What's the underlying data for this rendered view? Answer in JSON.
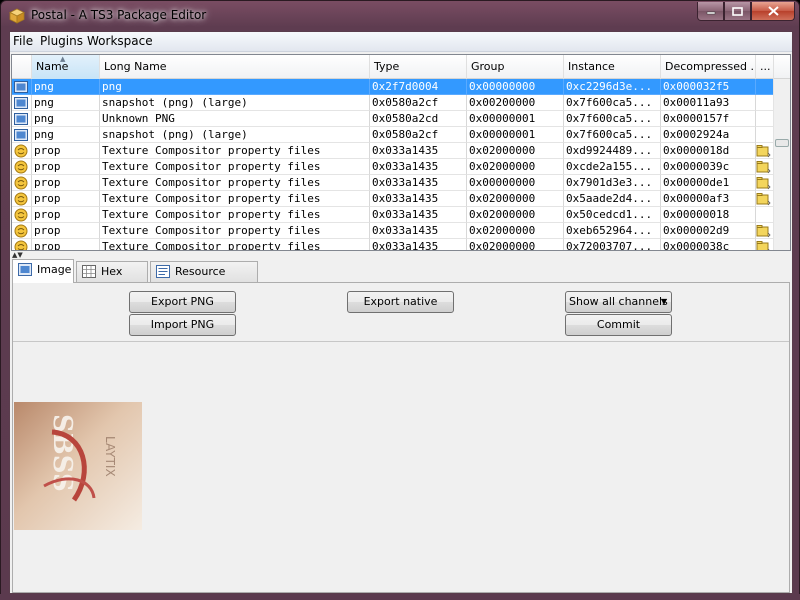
{
  "window": {
    "title": "Postal - A TS3 Package Editor",
    "accent": "#3399ff"
  },
  "caption_buttons": {
    "minimize": "minimize-icon",
    "maximize": "maximize-icon",
    "close": "close-icon"
  },
  "menu": [
    "File",
    "Plugins",
    "Workspace"
  ],
  "grid": {
    "columns": [
      "Name",
      "Long Name",
      "Type",
      "Group",
      "Instance",
      "Decompressed ...",
      "..."
    ],
    "sorted_column": "Name",
    "rows": [
      {
        "icon": "image-icon",
        "name": "png",
        "long_name": "png",
        "type": "0x2f7d0004",
        "group": "0x00000000",
        "instance": "0xc2296d3e...",
        "decompressed": "0x000032f5",
        "side_icon": "",
        "selected": true
      },
      {
        "icon": "image-icon",
        "name": "png",
        "long_name": "snapshot (png) (large)",
        "type": "0x0580a2cf",
        "group": "0x00200000",
        "instance": "0x7f600ca5...",
        "decompressed": "0x00011a93",
        "side_icon": "",
        "selected": false
      },
      {
        "icon": "image-icon",
        "name": "png",
        "long_name": "Unknown PNG",
        "type": "0x0580a2cd",
        "group": "0x00000001",
        "instance": "0x7f600ca5...",
        "decompressed": "0x0000157f",
        "side_icon": "",
        "selected": false
      },
      {
        "icon": "image-icon",
        "name": "png",
        "long_name": "snapshot (png) (large)",
        "type": "0x0580a2cf",
        "group": "0x00000001",
        "instance": "0x7f600ca5...",
        "decompressed": "0x0002924a",
        "side_icon": "",
        "selected": false
      },
      {
        "icon": "property-icon",
        "name": "prop",
        "long_name": "Texture Compositor property files",
        "type": "0x033a1435",
        "group": "0x02000000",
        "instance": "0xd9924489...",
        "decompressed": "0x0000018d",
        "side_icon": "folder-icon",
        "selected": false
      },
      {
        "icon": "property-icon",
        "name": "prop",
        "long_name": "Texture Compositor property files",
        "type": "0x033a1435",
        "group": "0x02000000",
        "instance": "0xcde2a155...",
        "decompressed": "0x0000039c",
        "side_icon": "folder-icon",
        "selected": false
      },
      {
        "icon": "property-icon",
        "name": "prop",
        "long_name": "Texture Compositor property files",
        "type": "0x033a1435",
        "group": "0x00000000",
        "instance": "0x7901d3e3...",
        "decompressed": "0x00000de1",
        "side_icon": "folder-icon",
        "selected": false
      },
      {
        "icon": "property-icon",
        "name": "prop",
        "long_name": "Texture Compositor property files",
        "type": "0x033a1435",
        "group": "0x02000000",
        "instance": "0x5aade2d4...",
        "decompressed": "0x00000af3",
        "side_icon": "folder-icon",
        "selected": false
      },
      {
        "icon": "property-icon",
        "name": "prop",
        "long_name": "Texture Compositor property files",
        "type": "0x033a1435",
        "group": "0x02000000",
        "instance": "0x50cedcd1...",
        "decompressed": "0x00000018",
        "side_icon": "",
        "selected": false
      },
      {
        "icon": "property-icon",
        "name": "prop",
        "long_name": "Texture Compositor property files",
        "type": "0x033a1435",
        "group": "0x02000000",
        "instance": "0xeb652964...",
        "decompressed": "0x000002d9",
        "side_icon": "folder-icon",
        "selected": false
      },
      {
        "icon": "property-icon",
        "name": "prop",
        "long_name": "Texture Compositor property files",
        "type": "0x033a1435",
        "group": "0x02000000",
        "instance": "0x72003707...",
        "decompressed": "0x0000038c",
        "side_icon": "folder-icon",
        "selected": false
      }
    ]
  },
  "tabs": [
    {
      "label": "Image",
      "icon": "image-icon",
      "active": true
    },
    {
      "label": "Hex View",
      "icon": "hex-grid-icon",
      "active": false
    },
    {
      "label": "Resource Details",
      "icon": "details-icon",
      "active": false
    }
  ],
  "image_panel": {
    "export_png": "Export PNG",
    "import_png": "Import PNG",
    "export_native": "Export native",
    "channels_select": "Show all channels",
    "commit": "Commit",
    "preview_image": "thumbnail-image"
  }
}
